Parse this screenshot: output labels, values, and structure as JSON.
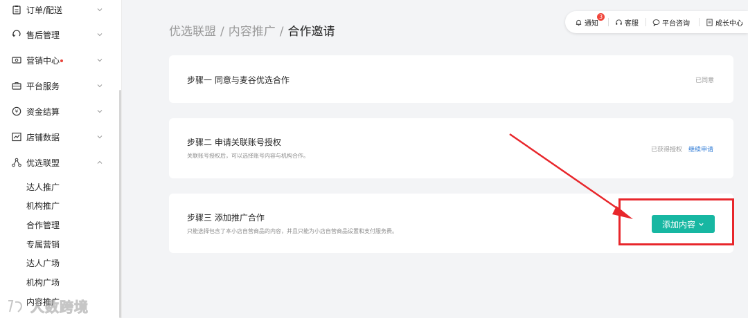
{
  "sidebar": {
    "menu": [
      {
        "label": "订单/配送",
        "icon": "clipboard-icon"
      },
      {
        "label": "售后管理",
        "icon": "after-sales-icon"
      },
      {
        "label": "营销中心",
        "icon": "marketing-icon"
      },
      {
        "label": "平台服务",
        "icon": "briefcase-icon"
      },
      {
        "label": "资金结算",
        "icon": "yen-coin-icon"
      },
      {
        "label": "店铺数据",
        "icon": "chart-icon"
      },
      {
        "label": "优选联盟",
        "icon": "network-icon"
      }
    ],
    "sub_items": [
      "达人推广",
      "机构推广",
      "合作管理",
      "专属营销",
      "达人广场",
      "机构广场",
      "内容推广"
    ]
  },
  "watermark": {
    "text": "人数跨境"
  },
  "breadcrumb": {
    "items": [
      "优选联盟",
      "内容推广"
    ],
    "current": "合作邀请",
    "separator": "/"
  },
  "topbar": {
    "notify_label": "通知",
    "notify_count": "3",
    "service_label": "客服",
    "consult_label": "平台咨询",
    "growth_label": "成长中心"
  },
  "steps": [
    {
      "title": "步骤一 同意与麦谷优选合作",
      "status": "已同意"
    },
    {
      "title": "步骤二 申请关联账号授权",
      "desc": "关联账号授权后，可以选择账号内容与机构合作。",
      "status": "已获得授权",
      "link": "继续申请"
    },
    {
      "title": "步骤三 添加推广合作",
      "desc": "只能选择包含了本小店自营商品的内容，并且只能为小店自营商品设置和支付服务费。",
      "button": "添加内容"
    }
  ],
  "colors": {
    "accent": "#17b7a2",
    "link": "#2f7bd6",
    "annotation": "#e8262b",
    "badge": "#f0453a"
  }
}
